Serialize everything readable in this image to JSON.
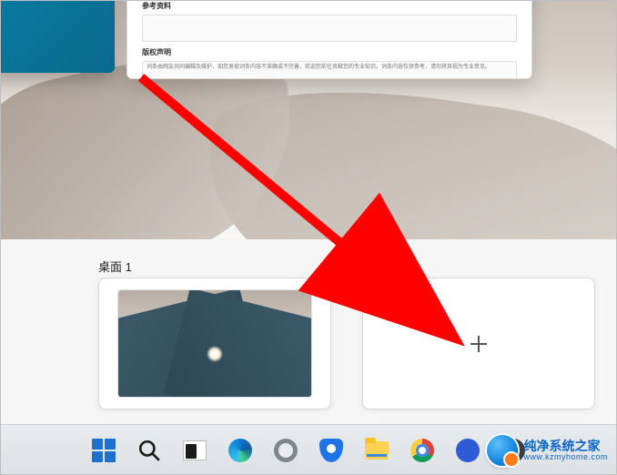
{
  "upper_window": {
    "section1_title": "参考资料",
    "section2_title": "版权声明",
    "fineprint": "词条由网友共同编辑及维护，如您发现词条内容不准确或不完善，欢迎您前往贡献您的专业知识。词条内容仅供参考，请勿将其视为专业意见。"
  },
  "task_view": {
    "desktop1_label": "桌面 1",
    "new_desktop_label": "新建桌面"
  },
  "taskbar": {
    "start_name": "start-button",
    "search_name": "search-button",
    "taskview_name": "task-view-button",
    "edge_name": "edge-app",
    "settings_name": "settings-app",
    "security_name": "security-app",
    "explorer_name": "file-explorer-app",
    "chrome_name": "chrome-app",
    "mail_name": "mail-app",
    "printer_name": "printer-app"
  },
  "watermark": {
    "title": "纯净系统之家",
    "url": "www.kzmyhome.com"
  },
  "colors": {
    "accent": "#2b66d9",
    "arrow": "#ff0000"
  }
}
